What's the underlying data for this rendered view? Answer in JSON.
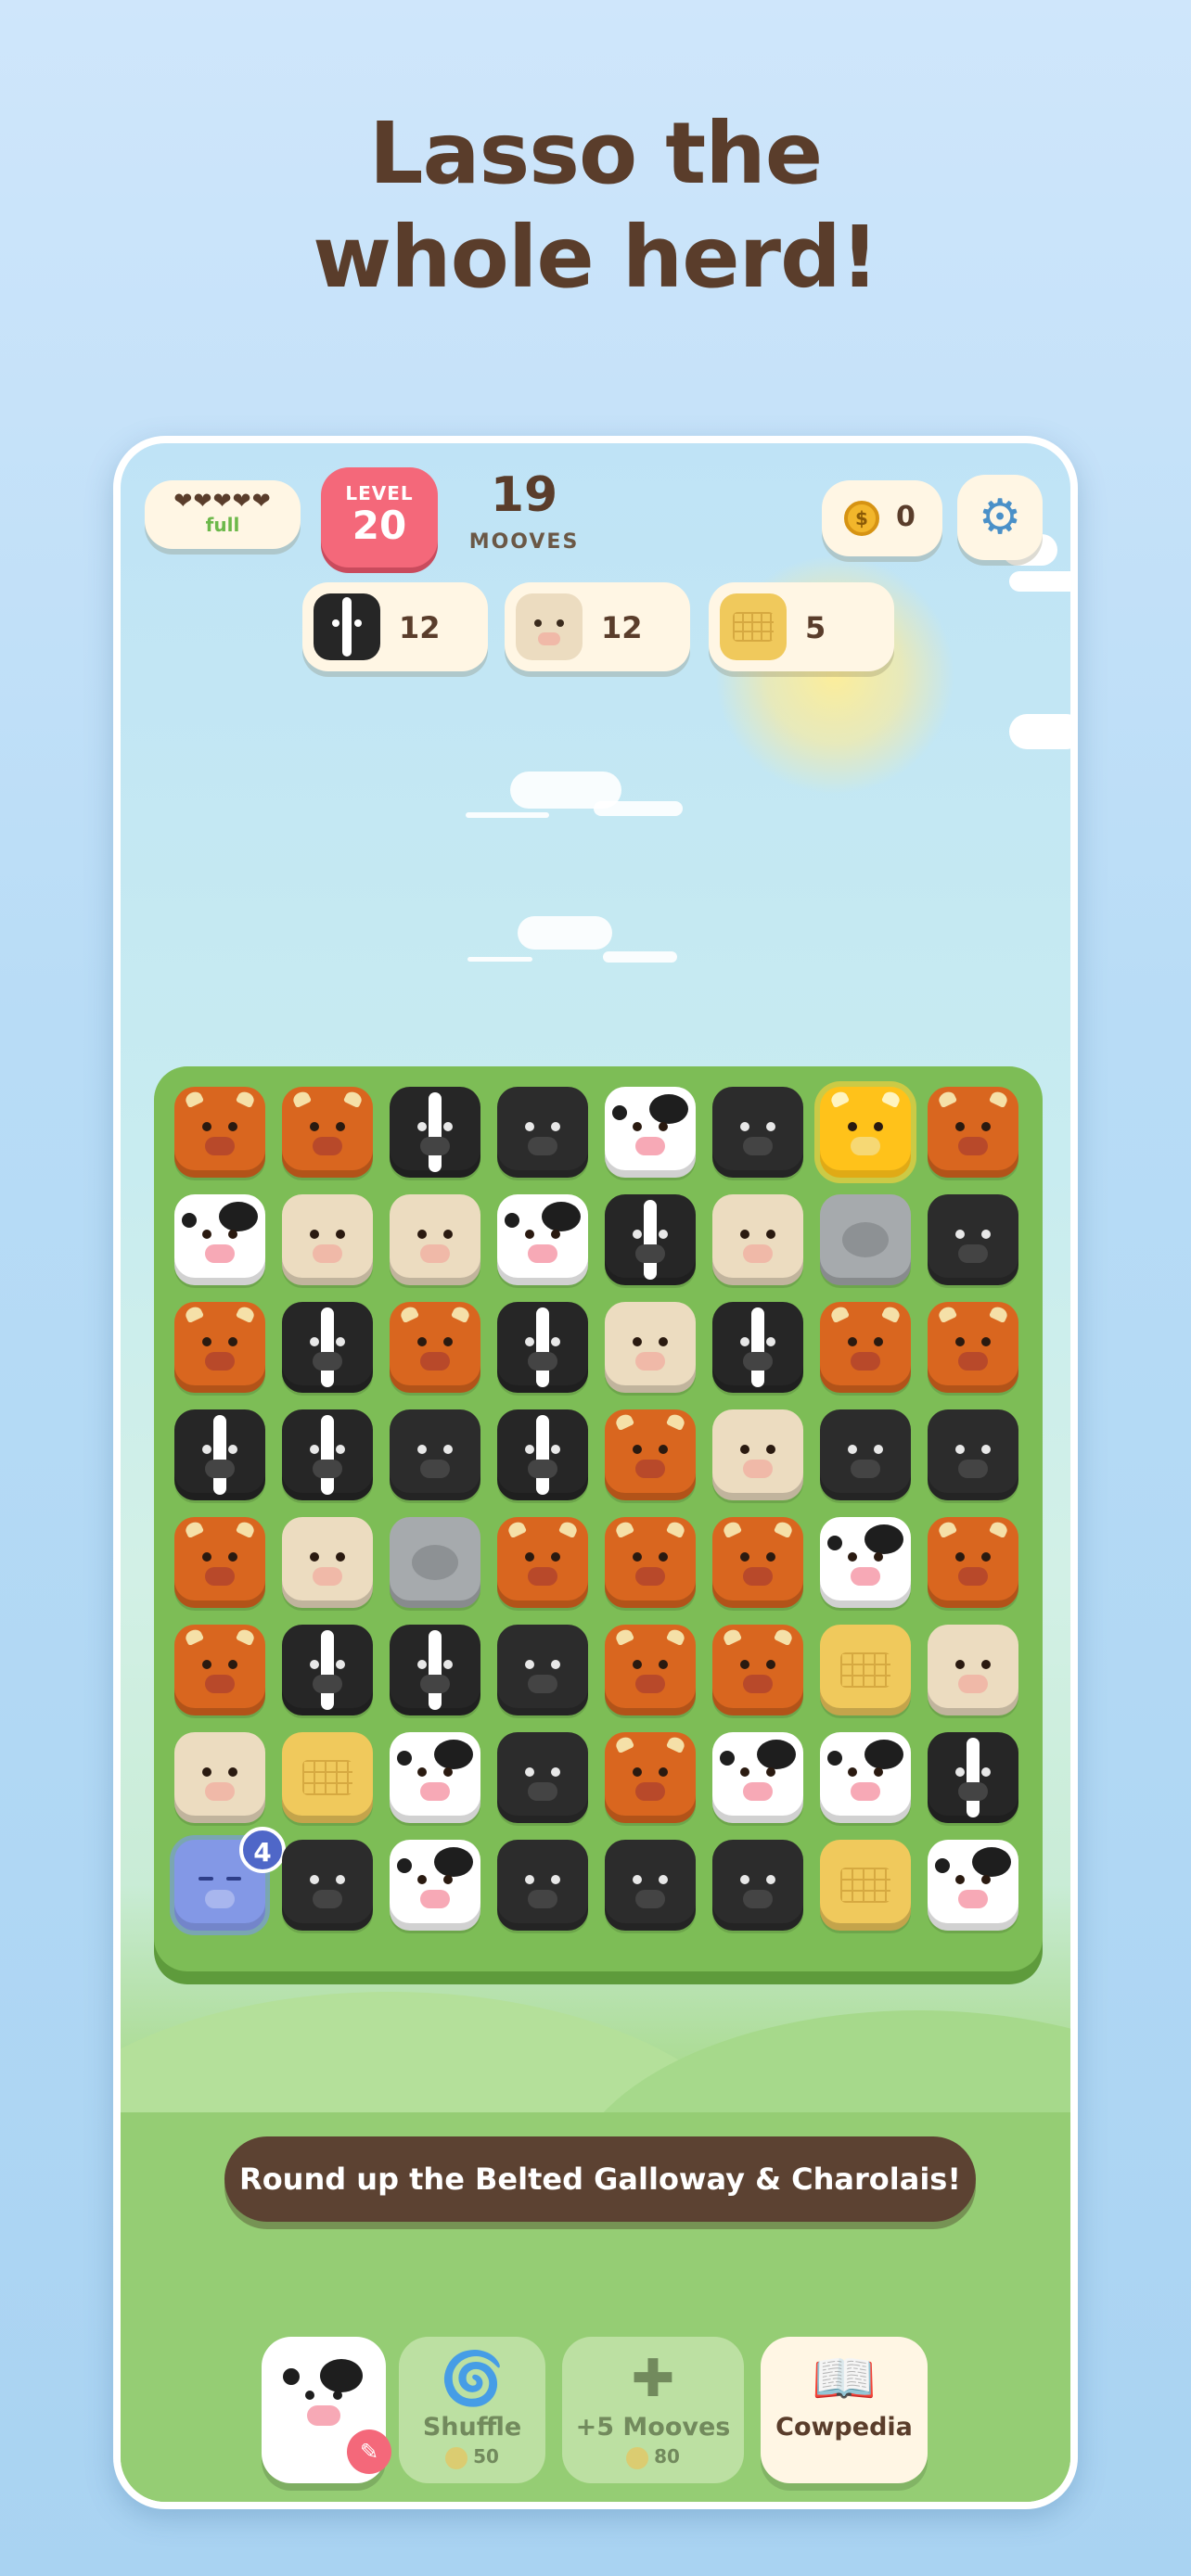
{
  "headline": {
    "line1": "Lasso the",
    "line2": "whole herd!"
  },
  "hud": {
    "lives": {
      "hearts": "❤❤❤❤❤",
      "status": "full"
    },
    "level": {
      "label": "LEVEL",
      "number": "20"
    },
    "moves": {
      "count": "19",
      "label": "MOOVES"
    },
    "coins": {
      "icon": "$",
      "value": "0"
    },
    "settings_icon": "⚙"
  },
  "goals": [
    {
      "piece": "belted-galloway",
      "count": "12"
    },
    {
      "piece": "charolais",
      "count": "12"
    },
    {
      "piece": "hay-bale",
      "count": "5"
    }
  ],
  "board": {
    "rows": [
      [
        "highland",
        "highland",
        "belted",
        "angus",
        "holstein",
        "angus",
        "golden",
        "highland"
      ],
      [
        "holstein",
        "charolais",
        "charolais",
        "holstein",
        "belted",
        "charolais",
        "rock",
        "angus"
      ],
      [
        "highland",
        "belted",
        "highland",
        "belted",
        "charolais",
        "belted",
        "highland",
        "highland"
      ],
      [
        "belted",
        "belted",
        "angus",
        "belted",
        "highland",
        "charolais",
        "angus",
        "angus"
      ],
      [
        "highland",
        "charolais",
        "rock",
        "highland",
        "highland",
        "highland",
        "holstein",
        "highland"
      ],
      [
        "highland",
        "belted",
        "belted",
        "angus",
        "highland",
        "highland",
        "hay",
        "charolais"
      ],
      [
        "charolais",
        "hay",
        "holstein",
        "angus",
        "highland",
        "holstein",
        "holstein",
        "belted"
      ],
      [
        "sleepy",
        "angus",
        "holstein",
        "angus",
        "angus",
        "angus",
        "hay",
        "holstein"
      ]
    ],
    "sleepy_badge": "4"
  },
  "colors": {
    "highland": "#d9661f",
    "belted": "#262626",
    "angus": "#2c2c2c",
    "holstein": "#ffffff",
    "charolais": "#ecdcc0",
    "golden": "#ffc21a",
    "rock": "#a6aaad",
    "hay": "#f0c95c",
    "sleepy": "#8398e6"
  },
  "hint_banner": "Round up the Belted Galloway & Charolais!",
  "toolbar": {
    "shuffle": {
      "icon": "🌀",
      "label": "Shuffle",
      "price": "50"
    },
    "extra_moves": {
      "icon": "✚",
      "label": "+5 Mooves",
      "price": "80"
    },
    "cowpedia": {
      "icon": "📖",
      "label": "Cowpedia"
    },
    "edit_icon": "✎"
  }
}
